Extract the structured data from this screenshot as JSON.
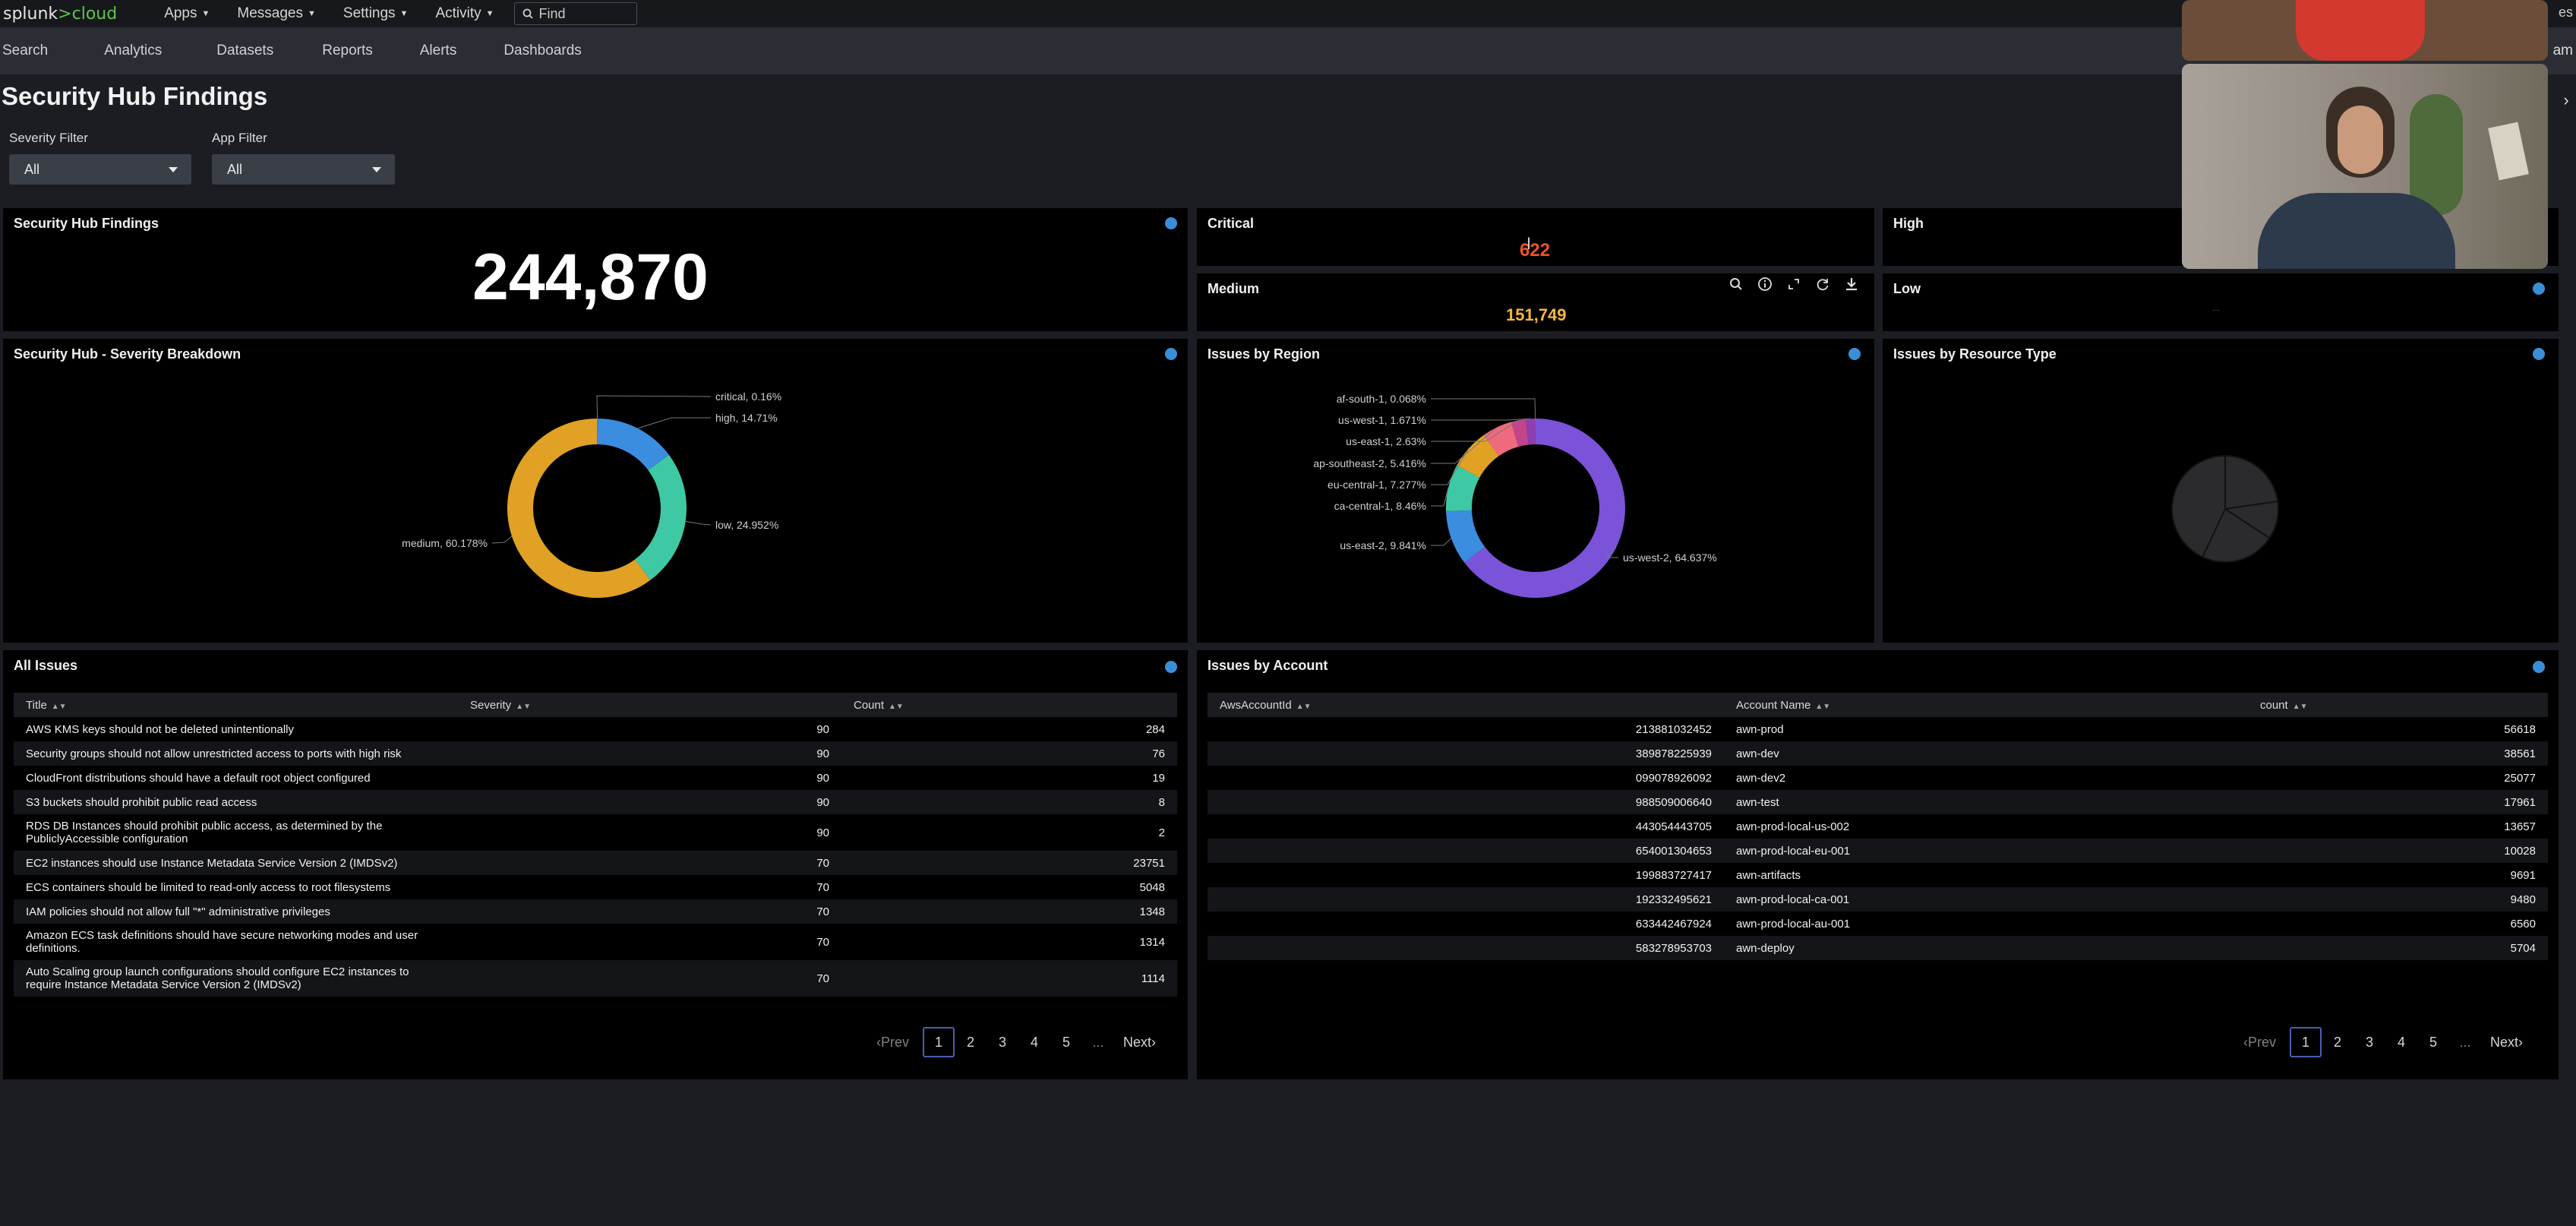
{
  "app": {
    "logo_text": "splunk",
    "logo_suffix": ">cloud"
  },
  "topmenu": {
    "items": [
      "Apps",
      "Messages",
      "Settings",
      "Activity"
    ],
    "find_placeholder": "Find",
    "right_text_1": "es",
    "right_text_2": "am"
  },
  "nav": {
    "items": [
      "Search",
      "Analytics",
      "Datasets",
      "Reports",
      "Alerts",
      "Dashboards"
    ]
  },
  "page_title": "Security Hub Findings",
  "filters": {
    "severity_label": "Severity Filter",
    "severity_value": "All",
    "app_label": "App Filter",
    "app_value": "All"
  },
  "kpis": {
    "total_title": "Security Hub Findings",
    "total_value": "244,870",
    "critical_title": "Critical",
    "critical_value": "622",
    "high_title": "High",
    "medium_title": "Medium",
    "medium_value": "151,749",
    "low_title": "Low",
    "low_value": "..."
  },
  "panels": {
    "severity_title": "Security Hub - Severity Breakdown",
    "region_title": "Issues by Region",
    "resource_title": "Issues by Resource Type",
    "all_issues_title": "All Issues",
    "account_title": "Issues by Account"
  },
  "severity_donut": {
    "slices": [
      {
        "label": "critical, 0.16%",
        "value": 0.16,
        "color": "#3b8de0"
      },
      {
        "label": "high, 14.71%",
        "value": 14.71,
        "color": "#3b8de0"
      },
      {
        "label": "low, 24.952%",
        "value": 24.952,
        "color": "#3ec9a4"
      },
      {
        "label": "medium, 60.178%",
        "value": 60.178,
        "color": "#e0a125"
      }
    ]
  },
  "region_donut": {
    "slices": [
      {
        "label": "us-west-2, 64.637%",
        "value": 64.637,
        "color": "#7b53d9"
      },
      {
        "label": "us-east-2, 9.841%",
        "value": 9.841,
        "color": "#3b8de0"
      },
      {
        "label": "ca-central-1, 8.46%",
        "value": 8.46,
        "color": "#3ec9a4"
      },
      {
        "label": "eu-central-1, 7.277%",
        "value": 7.277,
        "color": "#e0a125"
      },
      {
        "label": "ap-southeast-2, 5.416%",
        "value": 5.416,
        "color": "#f06a7e"
      },
      {
        "label": "us-east-1, 2.63%",
        "value": 2.63,
        "color": "#c0458b"
      },
      {
        "label": "us-west-1, 1.671%",
        "value": 1.671,
        "color": "#8d3fb0"
      },
      {
        "label": "af-south-1, 0.068%",
        "value": 0.068,
        "color": "#7b53d9"
      }
    ]
  },
  "all_issues": {
    "columns": [
      "Title",
      "Severity",
      "Count"
    ],
    "rows": [
      {
        "title": "AWS KMS keys should not be deleted unintentionally",
        "severity": "90",
        "count": "284"
      },
      {
        "title": "Security groups should not allow unrestricted access to ports with high risk",
        "severity": "90",
        "count": "76"
      },
      {
        "title": "CloudFront distributions should have a default root object configured",
        "severity": "90",
        "count": "19"
      },
      {
        "title": "S3 buckets should prohibit public read access",
        "severity": "90",
        "count": "8"
      },
      {
        "title": "RDS DB Instances should prohibit public access, as determined by the PubliclyAccessible configuration",
        "severity": "90",
        "count": "2"
      },
      {
        "title": "EC2 instances should use Instance Metadata Service Version 2 (IMDSv2)",
        "severity": "70",
        "count": "23751"
      },
      {
        "title": "ECS containers should be limited to read-only access to root filesystems",
        "severity": "70",
        "count": "5048"
      },
      {
        "title": "IAM policies should not allow full \"*\" administrative privileges",
        "severity": "70",
        "count": "1348"
      },
      {
        "title": "Amazon ECS task definitions should have secure networking modes and user definitions.",
        "severity": "70",
        "count": "1314"
      },
      {
        "title": "Auto Scaling group launch configurations should configure EC2 instances to require Instance Metadata Service Version 2 (IMDSv2)",
        "severity": "70",
        "count": "1114"
      }
    ]
  },
  "accounts": {
    "columns": [
      "AwsAccountId",
      "Account Name",
      "count"
    ],
    "rows": [
      {
        "id": "213881032452",
        "name": "awn-prod",
        "count": "56618"
      },
      {
        "id": "389878225939",
        "name": "awn-dev",
        "count": "38561"
      },
      {
        "id": "099078926092",
        "name": "awn-dev2",
        "count": "25077"
      },
      {
        "id": "988509006640",
        "name": "awn-test",
        "count": "17961"
      },
      {
        "id": "443054443705",
        "name": "awn-prod-local-us-002",
        "count": "13657"
      },
      {
        "id": "654001304653",
        "name": "awn-prod-local-eu-001",
        "count": "10028"
      },
      {
        "id": "199883727417",
        "name": "awn-artifacts",
        "count": "9691"
      },
      {
        "id": "192332495621",
        "name": "awn-prod-local-ca-001",
        "count": "9480"
      },
      {
        "id": "633442467924",
        "name": "awn-prod-local-au-001",
        "count": "6560"
      },
      {
        "id": "583278953703",
        "name": "awn-deploy",
        "count": "5704"
      }
    ]
  },
  "pager": {
    "prev": "Prev",
    "pages": [
      "1",
      "2",
      "3",
      "4",
      "5"
    ],
    "ellipsis": "...",
    "next": "Next"
  },
  "colors": {
    "accent": "#3a8ed8",
    "medium_value": "#f6b73c",
    "critical_value": "#e8552d"
  }
}
